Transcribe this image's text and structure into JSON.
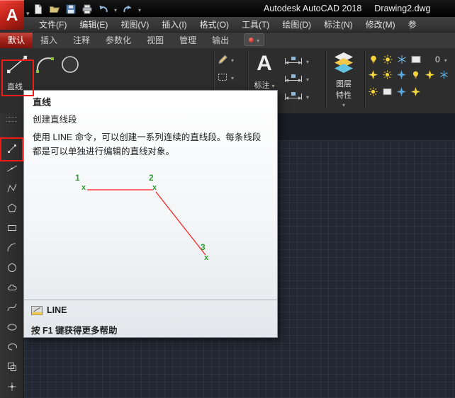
{
  "window": {
    "logo_letter": "A",
    "app_title": "Autodesk AutoCAD 2018",
    "doc_title": "Drawing2.dwg"
  },
  "menu_bar": {
    "items": [
      "文件(F)",
      "编辑(E)",
      "视图(V)",
      "插入(I)",
      "格式(O)",
      "工具(T)",
      "绘图(D)",
      "标注(N)",
      "修改(M)",
      "参"
    ]
  },
  "ribbon": {
    "tabs": [
      "默认",
      "插入",
      "注释",
      "参数化",
      "视图",
      "管理",
      "输出"
    ],
    "active_tab": "默认",
    "line_tool_label": "直线",
    "annotate_letter": "A",
    "annotate_label": "标注",
    "layers_label_line1": "图层",
    "layers_label_line2": "特性",
    "current_layer": "0"
  },
  "left_toolbar": {
    "tools": [
      "line",
      "construction-line",
      "polyline",
      "polygon",
      "rectangle",
      "arc",
      "circle",
      "revision-cloud",
      "spline",
      "ellipse",
      "ellipse-arc",
      "insert-block",
      "point"
    ]
  },
  "quick_access_icons": [
    "new-file-icon",
    "open-icon",
    "save-icon",
    "plot-icon",
    "undo-icon",
    "redo-icon"
  ],
  "tooltip": {
    "title": "直线",
    "subtitle": "创建直线段",
    "description": "使用 LINE 命令，可以创建一系列连续的直线段。每条线段都是可以单独进行编辑的直线对象。",
    "diagram": {
      "point_labels": [
        "1",
        "2",
        "3"
      ],
      "marker": "x",
      "line_color": "#ff0000",
      "marker_color": "#2f9e2f"
    },
    "command_name": "LINE",
    "footer_help": "按 F1 键获得更多帮助"
  },
  "colors": {
    "active_tab_red": "#a8251d",
    "annotation_red": "#ee1c16",
    "canvas_background": "#212834"
  }
}
